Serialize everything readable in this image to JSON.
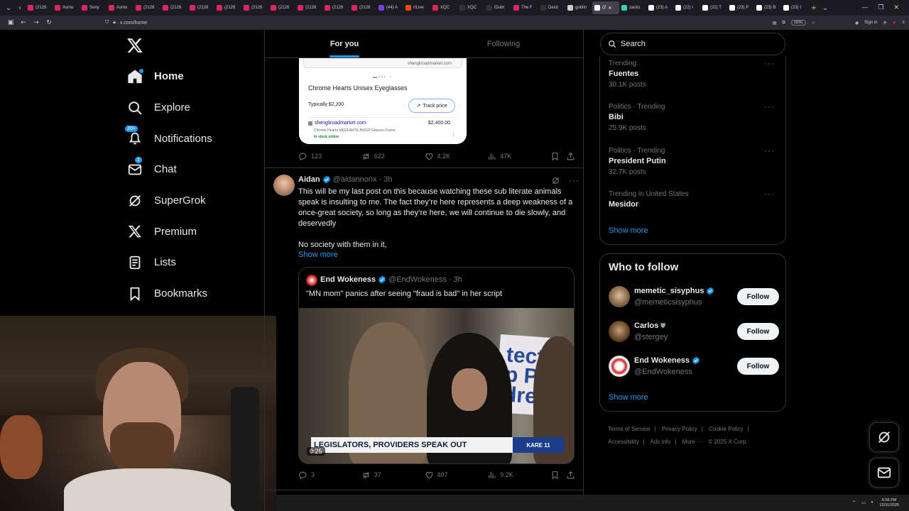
{
  "browser": {
    "tabs": [
      {
        "label": "(2126",
        "color": "#e0245e"
      },
      {
        "label": "Asmo",
        "color": "#e0245e"
      },
      {
        "label": "Sony",
        "color": "#e0245e"
      },
      {
        "label": "Asmo",
        "color": "#e0245e"
      },
      {
        "label": "(2126",
        "color": "#e0245e"
      },
      {
        "label": "(2126",
        "color": "#e0245e"
      },
      {
        "label": "(2126",
        "color": "#e0245e"
      },
      {
        "label": "(2126",
        "color": "#e0245e"
      },
      {
        "label": "(2126",
        "color": "#e0245e"
      },
      {
        "label": "(2126",
        "color": "#e0245e"
      },
      {
        "label": "(2126",
        "color": "#e0245e"
      },
      {
        "label": "(2126",
        "color": "#e0245e"
      },
      {
        "label": "(2126",
        "color": "#e0245e"
      },
      {
        "label": "(44) A",
        "color": "#7b3fe4"
      },
      {
        "label": "r/Live",
        "color": "#ff4500"
      },
      {
        "label": "XQC",
        "color": "#e0245e"
      },
      {
        "label": "XQC",
        "color": "#333"
      },
      {
        "label": "iDubt",
        "color": "#333"
      },
      {
        "label": "The F",
        "color": "#e0245e"
      },
      {
        "label": "Destr",
        "color": "#333"
      },
      {
        "label": "goblin",
        "color": "#ccc"
      },
      {
        "label": "(2",
        "color": "#fff",
        "active": true
      },
      {
        "label": "zacks",
        "color": "#2dd4bf"
      },
      {
        "label": "(23) A",
        "color": "#fff"
      },
      {
        "label": "(22) I",
        "color": "#fff"
      },
      {
        "label": "(22) T",
        "color": "#fff"
      },
      {
        "label": "(23) P",
        "color": "#fff"
      },
      {
        "label": "(23) B",
        "color": "#fff"
      },
      {
        "label": "(23) I",
        "color": "#fff"
      }
    ],
    "url": "x.com/home",
    "zoom": "150%",
    "sign_in": "Sign in"
  },
  "sidebar": {
    "items": [
      {
        "label": "Home",
        "icon": "home-icon"
      },
      {
        "label": "Explore",
        "icon": "search-icon"
      },
      {
        "label": "Notifications",
        "icon": "bell-icon",
        "badge": "20+"
      },
      {
        "label": "Chat",
        "icon": "mail-icon",
        "badge": "2"
      },
      {
        "label": "SuperGrok",
        "icon": "grok-icon"
      },
      {
        "label": "Premium",
        "icon": "x-logo-icon"
      },
      {
        "label": "Lists",
        "icon": "list-icon"
      },
      {
        "label": "Bookmarks",
        "icon": "bookmark-icon"
      }
    ]
  },
  "timeline": {
    "tabs": [
      "For you",
      "Following"
    ],
    "card": {
      "domain": "shengliroadmarket.com",
      "product": "Chrome Hearts Unisex Eyeglasses",
      "typically": "Typically $2,200",
      "track": "Track price",
      "shop": "shengliroadmarket.com",
      "price": "$2,400.00",
      "desc": "Chrome Hearts VAGILANTE BK/GP Glasses Frame",
      "stock": "In stock online"
    },
    "post1_stats": {
      "replies": "123",
      "reposts": "622",
      "likes": "4.2K",
      "views": "47K"
    },
    "post2": {
      "name": "Aidan",
      "handle": "@aidannonx",
      "time": "· 3h",
      "text": "This will be my last post on this because watching these sub literate animals speak is insulting to me. The fact they’re here represents a deep weakness of a once-great society, so long as they’re here, we will continue to die slowly, and deservedly\n\nNo society with them in it,",
      "show_more": "Show more",
      "quote": {
        "name": "End Wokeness",
        "handle": "@EndWokeness",
        "time": "· 3h",
        "text": "\"MN mom\" panics after seeing \"fraud is bad\" in her script",
        "banner": "LEGISLATORS, PROVIDERS SPEAK OUT",
        "station": "KARE 11",
        "sign": "tect\np Pro\ndren",
        "duration": "0:25"
      },
      "stats": {
        "replies": "3",
        "reposts": "37",
        "likes": "407",
        "views": "9.2K"
      }
    }
  },
  "right": {
    "search_placeholder": "Search",
    "trends": [
      {
        "context": "Trending",
        "title": "Fuentes",
        "count": "30.1K posts"
      },
      {
        "context": "Politics · Trending",
        "title": "Bibi",
        "count": "25.9K posts"
      },
      {
        "context": "Politics · Trending",
        "title": "President Putin",
        "count": "32.7K posts"
      },
      {
        "context": "Trending in United States",
        "title": "Mesidor",
        "count": ""
      }
    ],
    "trends_show_more": "Show more",
    "who_to_follow": {
      "title": "Who to follow",
      "accounts": [
        {
          "name": "memetic_sisyphus",
          "handle": "@memeticsisyphus",
          "verified": true,
          "follow": "Follow"
        },
        {
          "name": "Carlos",
          "handle": "@stergey",
          "verified": false,
          "follow": "Follow"
        },
        {
          "name": "End Wokeness",
          "handle": "@EndWokeness",
          "verified": true,
          "follow": "Follow"
        }
      ],
      "show_more": "Show more"
    },
    "footer": {
      "links": [
        "Terms of Service",
        "Privacy Policy",
        "Cookie Policy",
        "Accessibility",
        "Ads info",
        "More ···"
      ],
      "copyright": "© 2025 X Corp."
    }
  },
  "taskbar": {
    "time": "6:55 PM",
    "date": "12/31/2025"
  },
  "colors": {
    "accent": "#1d9bf0",
    "background": "#000000",
    "border": "#2f3336",
    "muted": "#71767b"
  }
}
